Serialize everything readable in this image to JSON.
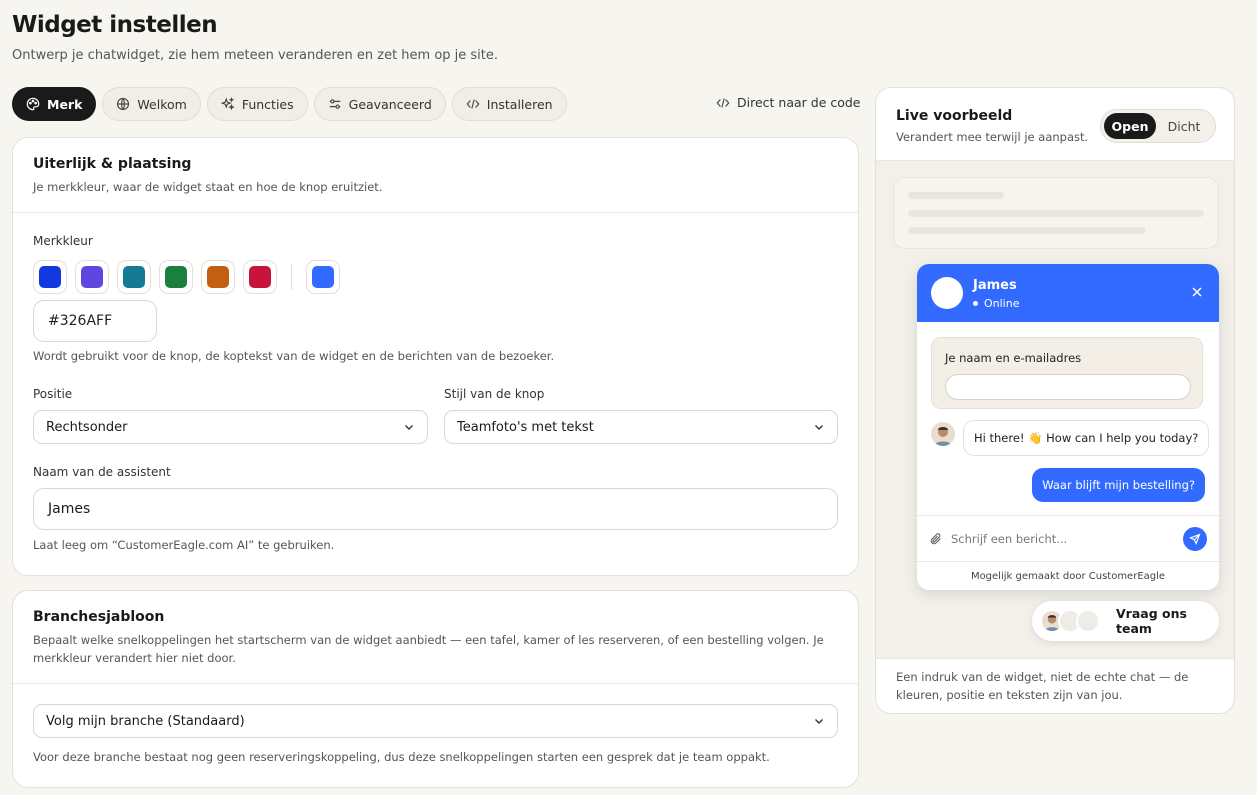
{
  "page": {
    "title": "Widget instellen",
    "subtitle": "Ontwerp je chatwidget, zie hem meteen veranderen en zet hem op je site."
  },
  "tabs": [
    {
      "label": "Merk",
      "icon": "palette-icon",
      "active": true
    },
    {
      "label": "Welkom",
      "icon": "globe-icon",
      "active": false
    },
    {
      "label": "Functies",
      "icon": "sparkles-icon",
      "active": false
    },
    {
      "label": "Geavanceerd",
      "icon": "sliders-icon",
      "active": false
    },
    {
      "label": "Installeren",
      "icon": "code-icon",
      "active": false
    }
  ],
  "direct_code_label": "Direct naar de code",
  "appearance": {
    "title": "Uiterlijk & plaatsing",
    "description": "Je merkkleur, waar de widget staat en hoe de knop eruitziet.",
    "brand_color_label": "Merkkleur",
    "swatches": [
      "#1438e0",
      "#6046e0",
      "#157a94",
      "#1a8040",
      "#c45f12",
      "#c8143c"
    ],
    "custom_swatch": "#326AFF",
    "hex_value": "#326AFF",
    "brand_color_help": "Wordt gebruikt voor de knop, de koptekst van de widget en de berichten van de bezoeker.",
    "position_label": "Positie",
    "position_value": "Rechtsonder",
    "button_style_label": "Stijl van de knop",
    "button_style_value": "Teamfoto's met tekst",
    "assistant_name_label": "Naam van de assistent",
    "assistant_name_value": "James",
    "assistant_name_help": "Laat leeg om “CustomerEagle.com AI” te gebruiken."
  },
  "industry": {
    "title": "Branchesjabloon",
    "description": "Bepaalt welke snelkoppelingen het startscherm van de widget aanbiedt — een tafel, kamer of les reserveren, of een bestelling volgen. Je merkkleur verandert hier niet door.",
    "select_value": "Volg mijn branche (Standaard)",
    "help": "Voor deze branche bestaat nog geen reserveringskoppeling, dus deze snelkoppelingen starten een gesprek dat je team oppakt."
  },
  "preview": {
    "title": "Live voorbeeld",
    "subtitle": "Verandert mee terwijl je aanpast.",
    "toggle_open": "Open",
    "toggle_closed": "Dicht",
    "chat": {
      "name": "James",
      "status": "Online",
      "form_label": "Je naam en e-mailadres",
      "bot_message": "Hi there! 👋 How can I help you today?",
      "user_message": "Waar blijft mijn bestelling?",
      "composer_placeholder": "Schrijf een bericht...",
      "powered_by": "Mogelijk gemaakt door CustomerEagle"
    },
    "launcher_label": "Vraag ons team",
    "footer": "Een indruk van de widget, niet de echte chat — de kleuren, positie en teksten zijn van jou."
  },
  "colors": {
    "brand": "#326AFF",
    "dark": "#1a1a1a",
    "background": "#f7f5f0"
  }
}
